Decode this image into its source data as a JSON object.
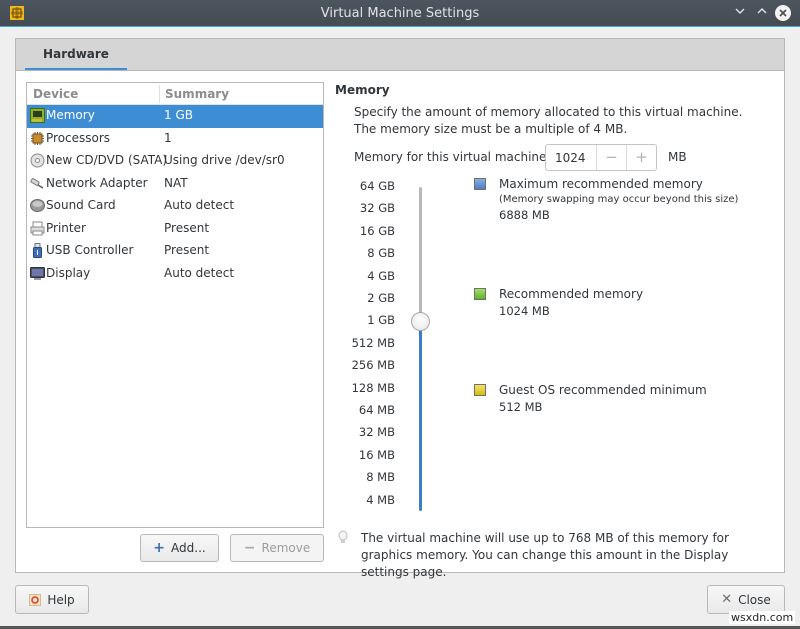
{
  "window": {
    "title": "Virtual Machine Settings",
    "controls": [
      "minimize",
      "maximize",
      "close"
    ]
  },
  "tabs": [
    {
      "label": "Hardware",
      "active": true
    }
  ],
  "device_list": {
    "headers": {
      "device": "Device",
      "summary": "Summary"
    },
    "rows": [
      {
        "icon": "memory-icon",
        "name": "Memory",
        "summary": "1 GB",
        "selected": true
      },
      {
        "icon": "processor-icon",
        "name": "Processors",
        "summary": "1",
        "selected": false
      },
      {
        "icon": "cd-dvd-icon",
        "name": "New CD/DVD (SATA)",
        "summary": "Using drive /dev/sr0",
        "selected": false
      },
      {
        "icon": "network-icon",
        "name": "Network Adapter",
        "summary": "NAT",
        "selected": false
      },
      {
        "icon": "sound-card-icon",
        "name": "Sound Card",
        "summary": "Auto detect",
        "selected": false
      },
      {
        "icon": "printer-icon",
        "name": "Printer",
        "summary": "Present",
        "selected": false
      },
      {
        "icon": "usb-icon",
        "name": "USB Controller",
        "summary": "Present",
        "selected": false
      },
      {
        "icon": "display-icon",
        "name": "Display",
        "summary": "Auto detect",
        "selected": false
      }
    ],
    "add_label": "Add...",
    "remove_label": "Remove"
  },
  "memory": {
    "title": "Memory",
    "description": "Specify the amount of memory allocated to this virtual machine. The memory size must be a multiple of 4 MB.",
    "field_label": "Memory for this virtual machine:",
    "value": "1024",
    "unit": "MB",
    "slider": {
      "ticks": [
        "64 GB",
        "32 GB",
        "16 GB",
        "8 GB",
        "4 GB",
        "2 GB",
        "1 GB",
        "512 MB",
        "256 MB",
        "128 MB",
        "64 MB",
        "32 MB",
        "16 MB",
        "8 MB",
        "4 MB"
      ],
      "current": "1 GB"
    },
    "legend": [
      {
        "label": "Maximum recommended memory",
        "note": "(Memory swapping may occur beyond this size)",
        "value": "6888 MB",
        "color": "#5b8fd0"
      },
      {
        "label": "Recommended memory",
        "value": "1024 MB",
        "color": "#72c72f"
      },
      {
        "label": "Guest OS recommended minimum",
        "value": "512 MB",
        "color": "#e0cf2a"
      }
    ],
    "hint": "The virtual machine will use up to 768 MB of this memory for graphics memory. You can change this amount in the Display settings page."
  },
  "footer": {
    "help_label": "Help",
    "close_label": "Close"
  },
  "watermark": "wsxdn.com",
  "colors": {
    "accent": "#3d8dd5",
    "titlebar": "#475059",
    "slider_fill": "#3d7fc4"
  }
}
